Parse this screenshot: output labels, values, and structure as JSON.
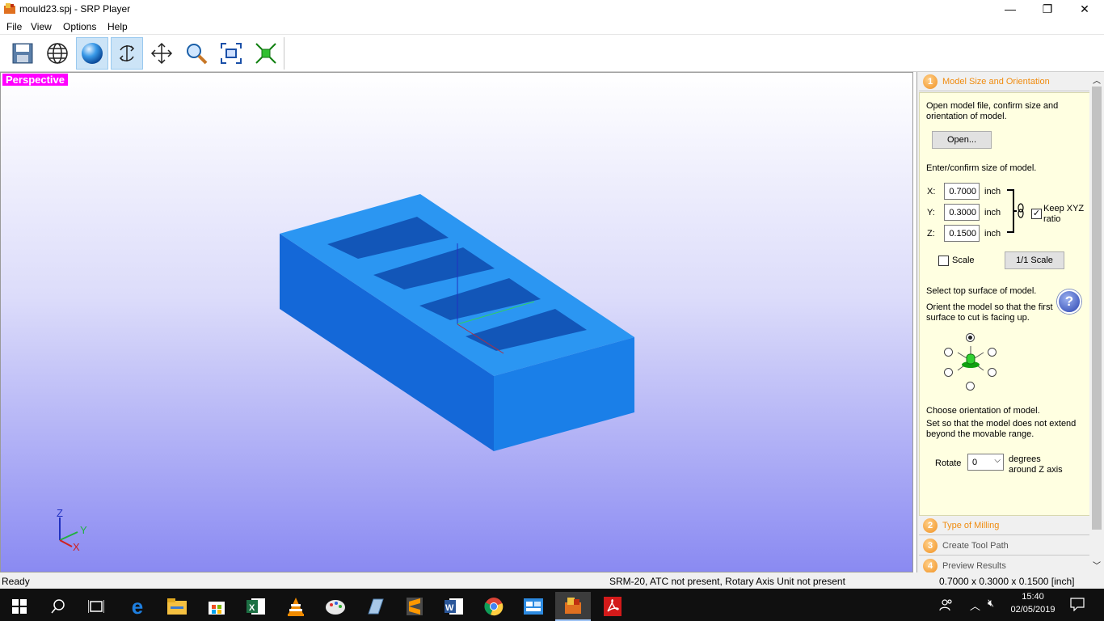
{
  "window": {
    "title": "mould23.spj - SRP Player",
    "minimize_glyph": "—",
    "maximize_glyph": "❐",
    "close_glyph": "✕"
  },
  "menu": [
    "File",
    "View",
    "Options",
    "Help"
  ],
  "toolbar": {
    "buttons": [
      "save-icon",
      "wireframe-icon",
      "shaded-sphere-icon",
      "rotate-icon",
      "pan-icon",
      "zoom-icon",
      "fit-view-icon",
      "reset-view-icon"
    ],
    "active": [
      "shaded-sphere-icon",
      "rotate-icon"
    ]
  },
  "viewport": {
    "view_label": "Perspective",
    "axis_z": "Z",
    "axis_y": "Y",
    "axis_x": "X",
    "model_color": "#1e8ff0"
  },
  "panel": {
    "steps": [
      {
        "num": "1",
        "title": "Model Size and Orientation",
        "state": "active"
      },
      {
        "num": "2",
        "title": "Type of Milling",
        "state": "orange"
      },
      {
        "num": "3",
        "title": "Create Tool Path",
        "state": "gray"
      },
      {
        "num": "4",
        "title": "Preview Results",
        "state": "gray"
      }
    ],
    "open_text_1": "Open model file, confirm size and",
    "open_text_2": "orientation of model.",
    "open_button": "Open...",
    "size_text": "Enter/confirm size of model.",
    "x_label": "X:",
    "x_value": "0.7000",
    "y_label": "Y:",
    "y_value": "0.3000",
    "z_label": "Z:",
    "z_value": "0.1500",
    "unit": "inch",
    "keep_ratio_1": "Keep XYZ",
    "keep_ratio_2": "ratio",
    "keep_ratio_checked": true,
    "scale_label": "Scale",
    "scale_checked": false,
    "scale_button": "1/1 Scale",
    "top_surface_text": "Select top surface of model.",
    "orient_text_1": "Orient the model so that the first",
    "orient_text_2": "surface to cut is facing up.",
    "help_glyph": "?",
    "choose_orient": "Choose orientation of model.",
    "movable_1": "Set so that the model does not extend",
    "movable_2": "beyond the movable range.",
    "rotate_label": "Rotate",
    "rotate_value": "0",
    "degrees_1": "degrees",
    "degrees_2": "around Z axis"
  },
  "status": {
    "left": "Ready",
    "middle": "SRM-20, ATC not present, Rotary Axis Unit not present",
    "right": "0.7000 x 0.3000 x 0.1500 [inch]"
  },
  "taskbar": {
    "apps": [
      "windows-start-icon",
      "search-icon",
      "task-view-icon",
      "edge-icon",
      "file-explorer-icon",
      "store-icon",
      "excel-icon",
      "vlc-icon",
      "paint-icon",
      "app-icon",
      "sublime-icon",
      "word-icon",
      "chrome-icon",
      "control-panel-icon",
      "srp-player-icon",
      "acrobat-icon"
    ],
    "time": "15:40",
    "date": "02/05/2019"
  }
}
